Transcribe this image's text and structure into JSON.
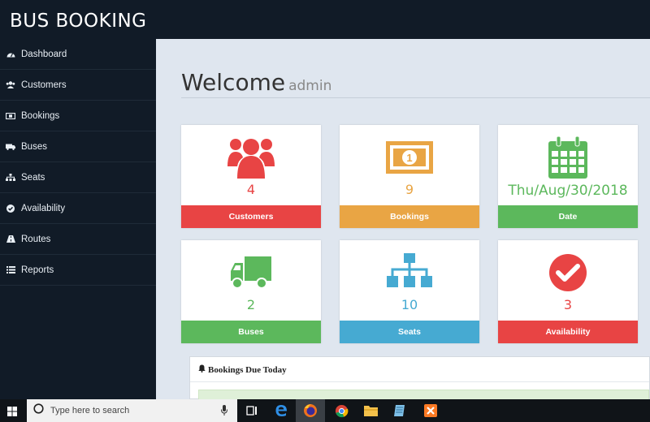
{
  "app": {
    "brand": "BUS BOOKING"
  },
  "sidebar": {
    "items": [
      {
        "label": "Dashboard",
        "icon": "dashboard-icon"
      },
      {
        "label": "Customers",
        "icon": "users-icon"
      },
      {
        "label": "Bookings",
        "icon": "ticket-icon"
      },
      {
        "label": "Buses",
        "icon": "bus-icon"
      },
      {
        "label": "Seats",
        "icon": "seats-icon"
      },
      {
        "label": "Availability",
        "icon": "check-circle-icon"
      },
      {
        "label": "Routes",
        "icon": "road-icon"
      },
      {
        "label": "Reports",
        "icon": "list-icon"
      }
    ]
  },
  "welcome": {
    "title": "Welcome",
    "user": "admin"
  },
  "cards": [
    {
      "value": "4",
      "label": "Customers",
      "icon": "users-icon",
      "color": "#e84444"
    },
    {
      "value": "9",
      "label": "Bookings",
      "icon": "money-icon",
      "color": "#e9a544"
    },
    {
      "value": "Thu/Aug/30/2018",
      "label": "Date",
      "icon": "calendar-icon",
      "color": "#5cb85c"
    },
    {
      "value": "2",
      "label": "Buses",
      "icon": "truck-icon",
      "color": "#5cb85c"
    },
    {
      "value": "10",
      "label": "Seats",
      "icon": "sitemap-icon",
      "color": "#46aad2"
    },
    {
      "value": "3",
      "label": "Availability",
      "icon": "check-circle-icon",
      "color": "#e84444"
    }
  ],
  "panel": {
    "title": "Bookings Due Today"
  },
  "taskbar": {
    "search_placeholder": "Type here to search"
  }
}
